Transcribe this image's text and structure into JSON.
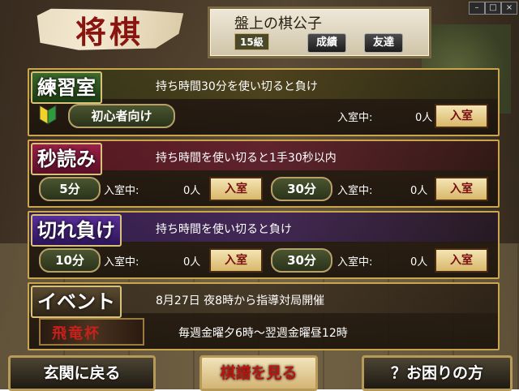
{
  "app": {
    "logo": "将棋"
  },
  "player": {
    "name": "盤上の棋公子",
    "rank": "15級",
    "results_label": "成績",
    "friends_label": "友達"
  },
  "enter_label": "入室",
  "sections": {
    "practice": {
      "title": "練習室",
      "desc": "持ち時間30分を使い切ると負け",
      "rooms": [
        {
          "label": "初心者向け",
          "occupancy_label": "入室中:",
          "count": "0人"
        }
      ]
    },
    "byoyomi": {
      "title": "秒読み",
      "desc": "持ち時間を使い切ると1手30秒以内",
      "rooms": [
        {
          "label": "5分",
          "occupancy_label": "入室中:",
          "count": "0人"
        },
        {
          "label": "30分",
          "occupancy_label": "入室中:",
          "count": "0人"
        }
      ]
    },
    "kiremake": {
      "title": "切れ負け",
      "desc": "持ち時間を使い切ると負け",
      "rooms": [
        {
          "label": "10分",
          "occupancy_label": "入室中:",
          "count": "0人"
        },
        {
          "label": "30分",
          "occupancy_label": "入室中:",
          "count": "0人"
        }
      ]
    },
    "event": {
      "title": "イベント",
      "desc": "8月27日 夜8時から指導対局開催",
      "logo": "飛竜杯",
      "schedule": "毎週金曜夕6時～翌週金曜昼12時"
    }
  },
  "footer": {
    "back_label": "玄関に戻る",
    "kifu_label": "棋譜を見る",
    "help_label": "？お困りの方"
  }
}
